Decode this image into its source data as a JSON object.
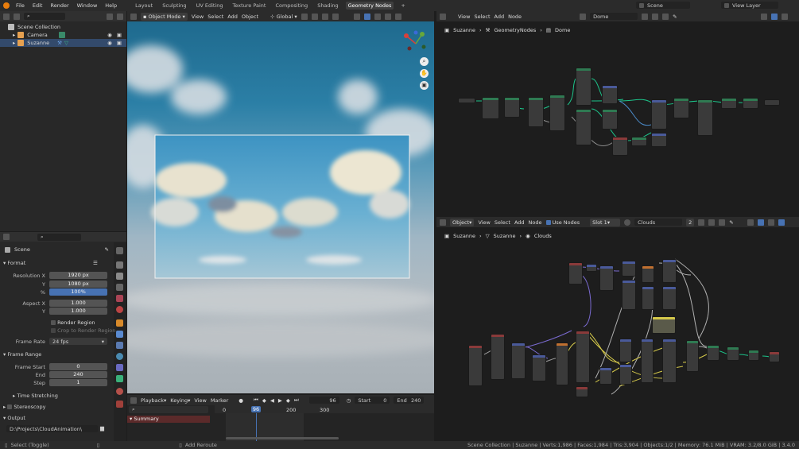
{
  "menu": {
    "file": "File",
    "edit": "Edit",
    "render": "Render",
    "window": "Window",
    "help": "Help"
  },
  "workspaces": [
    "Layout",
    "Sculpting",
    "UV Editing",
    "Texture Paint",
    "Compositing",
    "Shading",
    "Geometry Nodes",
    "+"
  ],
  "scene_selector": "Scene",
  "view_layer": "View Layer",
  "outliner": {
    "collection": "Scene Collection",
    "items": [
      {
        "label": "Camera"
      },
      {
        "label": "Suzanne"
      }
    ]
  },
  "viewport_header": {
    "mode": "Object Mode",
    "view": "View",
    "select": "Select",
    "add": "Add",
    "object": "Object",
    "orientation": "Global"
  },
  "node_editor_top": {
    "view": "View",
    "select": "Select",
    "add": "Add",
    "node": "Node",
    "tree": "Dome",
    "breadcrumb": [
      "Suzanne",
      "GeometryNodes",
      "Dome"
    ]
  },
  "node_editor_bottom": {
    "type": "Object",
    "view": "View",
    "select": "Select",
    "add": "Add",
    "node": "Node",
    "use_nodes": "Use Nodes",
    "slot": "Slot 1",
    "material": "Clouds",
    "users": "2",
    "breadcrumb": [
      "Suzanne",
      "Suzanne",
      "Clouds"
    ]
  },
  "properties": {
    "context": "Scene",
    "format_title": "Format",
    "res_x_label": "Resolution X",
    "res_x": "1920 px",
    "res_y_label": "Y",
    "res_y": "1080 px",
    "pct_label": "%",
    "pct": "100%",
    "aspect_x_label": "Aspect X",
    "aspect_x": "1.000",
    "aspect_y_label": "Y",
    "aspect_y": "1.000",
    "render_region": "Render Region",
    "crop": "Crop to Render Region",
    "frame_rate_label": "Frame Rate",
    "frame_rate": "24 fps",
    "frame_range_title": "Frame Range",
    "frame_start_label": "Frame Start",
    "frame_start": "0",
    "end_label": "End",
    "end": "240",
    "step_label": "Step",
    "step": "1",
    "time_stretching": "Time Stretching",
    "stereoscopy": "Stereoscopy",
    "output_title": "Output",
    "output_path": "D:\\Projects\\CloudAnimation\\"
  },
  "timeline": {
    "playback": "Playback",
    "keying": "Keying",
    "view": "View",
    "marker": "Marker",
    "current": "96",
    "start_label": "Start",
    "start": "0",
    "end_label": "End",
    "end": "240",
    "ticks": [
      "0",
      "96",
      "200",
      "300"
    ],
    "summary": "Summary"
  },
  "status": {
    "left": "Select (Toggle)",
    "mid": "Add Reroute",
    "right": "Scene Collection | Suzanne | Verts:1,986 | Faces:1,984 | Tris:3,904 | Objects:1/2 | Memory: 76.1 MiB | VRAM: 3.2/8.0 GiB | 3.4.0"
  },
  "colors": {
    "accent": "#4772b3",
    "node_green": "#2f7a52",
    "node_blue": "#4a5a9a",
    "node_red": "#8a3a3a",
    "wire_green": "#1cc48a",
    "wire_yellow": "#d4c84a",
    "wire_purple": "#7a6ad0"
  }
}
